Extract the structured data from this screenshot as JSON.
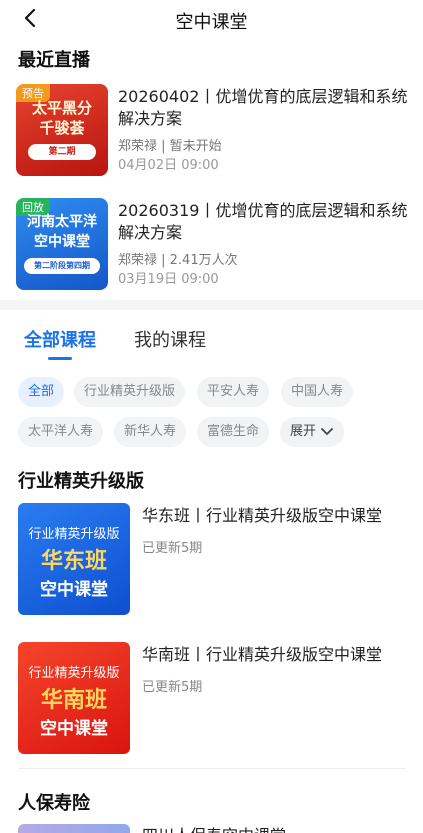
{
  "header": {
    "title": "空中课堂"
  },
  "recent_live": {
    "section_title": "最近直播",
    "items": [
      {
        "tag": "预告",
        "thumb_line1": "太平黑分",
        "thumb_line2": "千骏荟",
        "thumb_pill": "第二期",
        "title": "20260402丨优增优育的底层逻辑和系统解决方案",
        "meta": "郑荣禄 | 暂未开始",
        "date": "04月02日 09:00"
      },
      {
        "tag": "回放",
        "thumb_line1": "河南太平洋",
        "thumb_line2": "空中课堂",
        "thumb_pill": "第二阶段第四期",
        "title": "20260319丨优增优育的底层逻辑和系统解决方案",
        "meta": "郑荣禄 | 2.41万人次",
        "date": "03月19日 09:00"
      }
    ]
  },
  "tabs": [
    {
      "label": "全部课程",
      "active": true
    },
    {
      "label": "我的课程",
      "active": false
    }
  ],
  "filters": {
    "chips": [
      "全部",
      "行业精英升级版",
      "平安人寿",
      "中国人寿",
      "太平洋人寿",
      "新华人寿",
      "富德生命"
    ],
    "expand_label": "展开",
    "selected": "全部"
  },
  "sections": [
    {
      "title": "行业精英升级版",
      "courses": [
        {
          "thumb_top": "行业精英升级版",
          "thumb_main": "华东班",
          "thumb_bottom": "空中课堂",
          "title": "华东班丨行业精英升级版空中课堂",
          "meta": "已更新5期"
        },
        {
          "thumb_top": "行业精英升级版",
          "thumb_main": "华南班",
          "thumb_bottom": "空中课堂",
          "title": "华南班丨行业精英升级版空中课堂",
          "meta": "已更新5期"
        }
      ]
    },
    {
      "title": "人保寿险",
      "courses": [
        {
          "title": "四川人保寿空中课堂"
        }
      ]
    }
  ],
  "colors": {
    "accent": "#1a73e8",
    "live_thumb_1": "#d8261c",
    "live_thumb_2": "#1e7de0",
    "course_thumb_1": "#1466e0",
    "course_thumb_2": "#ee2a1c"
  }
}
